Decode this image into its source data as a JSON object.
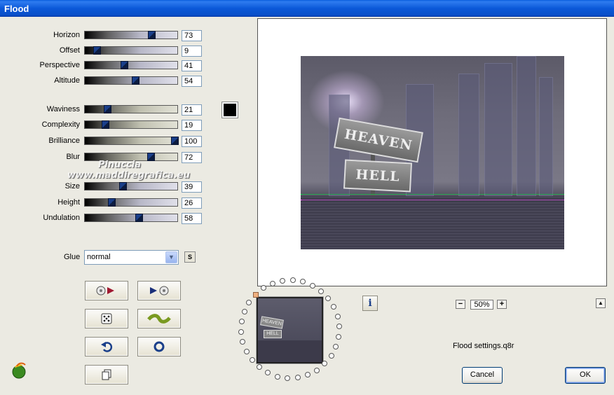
{
  "window": {
    "title": "Flood"
  },
  "sliders": [
    {
      "label": "Horizon",
      "value": "73",
      "level": 0.73
    },
    {
      "label": "Offset",
      "value": "9",
      "level": 0.09
    },
    {
      "label": "Perspective",
      "value": "41",
      "level": 0.41
    },
    {
      "label": "Altitude",
      "value": "54",
      "level": 0.54
    },
    {
      "label": "Waviness",
      "value": "21",
      "level": 0.21
    },
    {
      "label": "Complexity",
      "value": "19",
      "level": 0.19
    },
    {
      "label": "Brilliance",
      "value": "100",
      "level": 1.0
    },
    {
      "label": "Blur",
      "value": "72",
      "level": 0.72
    },
    {
      "label": "Size",
      "value": "39",
      "level": 0.39
    },
    {
      "label": "Height",
      "value": "26",
      "level": 0.26
    },
    {
      "label": "Undulation",
      "value": "58",
      "level": 0.58
    }
  ],
  "color_swatch": "#000000",
  "glue": {
    "label": "Glue",
    "value": "normal",
    "s_button": "S"
  },
  "tool_buttons": [
    "dice-arrow-icon",
    "arrow-dice-icon",
    "random-dice-icon",
    "wave-icon",
    "undo-arrow-icon",
    "reset-circle-icon",
    "copy-page-icon"
  ],
  "preview": {
    "sign_top": "HEAVEN",
    "sign_bottom": "HELL",
    "watermark_line1": "Pinuccia",
    "watermark_line2": "www.maddiregrafica.eu"
  },
  "zoom": {
    "minus": "−",
    "value": "50%",
    "plus": "+"
  },
  "status": {
    "text": "Flood settings.q8r"
  },
  "buttons": {
    "cancel": "Cancel",
    "ok": "OK"
  },
  "accent_colors": {
    "titlebar": "#0a4fc8",
    "slider_thumb": "#1a3f8a"
  }
}
